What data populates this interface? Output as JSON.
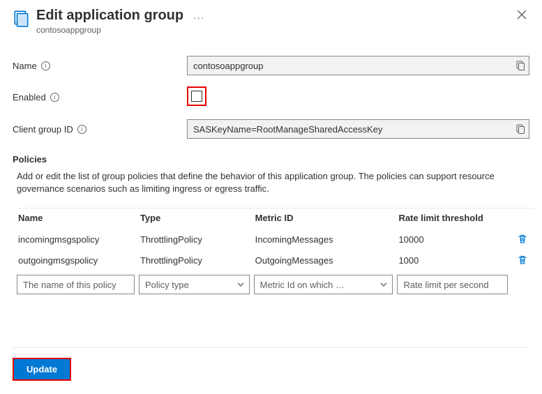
{
  "header": {
    "title": "Edit application group",
    "subtitle": "contosoappgroup"
  },
  "fields": {
    "name_label": "Name",
    "name_value": "contosoappgroup",
    "enabled_label": "Enabled",
    "clientgroupid_label": "Client group ID",
    "clientgroupid_value": "SASKeyName=RootManageSharedAccessKey"
  },
  "policies": {
    "section_title": "Policies",
    "description": "Add or edit the list of group policies that define the behavior of this application group. The policies can support resource governance scenarios such as limiting ingress or egress traffic.",
    "columns": {
      "name": "Name",
      "type": "Type",
      "metric": "Metric ID",
      "threshold": "Rate limit threshold"
    },
    "rows": [
      {
        "name": "incomingmsgspolicy",
        "type": "ThrottlingPolicy",
        "metric": "IncomingMessages",
        "threshold": "10000"
      },
      {
        "name": "outgoingmsgspolicy",
        "type": "ThrottlingPolicy",
        "metric": "OutgoingMessages",
        "threshold": "1000"
      }
    ],
    "placeholders": {
      "name": "The name of this policy",
      "type": "Policy type",
      "metric": "Metric Id on which …",
      "threshold": "Rate limit per second"
    }
  },
  "footer": {
    "update_label": "Update"
  }
}
